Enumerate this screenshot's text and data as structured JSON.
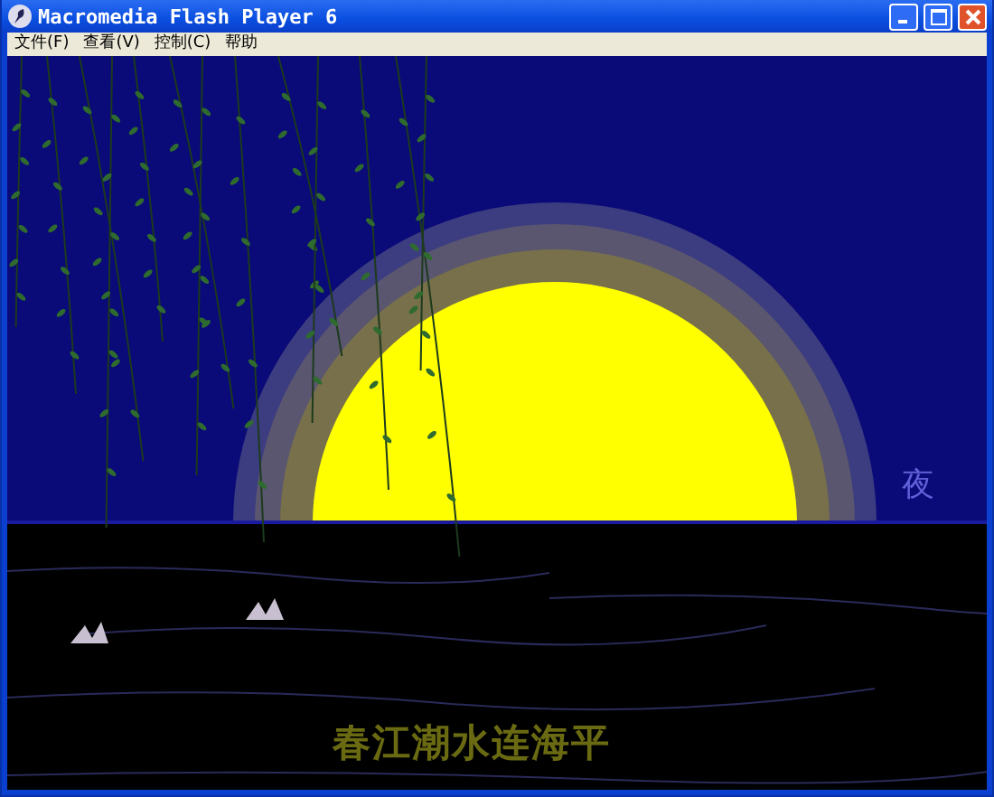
{
  "window": {
    "title": "Macromedia Flash Player 6"
  },
  "menu": [
    {
      "label": "文件(F)"
    },
    {
      "label": "查看(V)"
    },
    {
      "label": "控制(C)"
    },
    {
      "label": "帮助"
    }
  ],
  "stage": {
    "corner_text": "夜",
    "poem": "春江潮水连海平"
  }
}
